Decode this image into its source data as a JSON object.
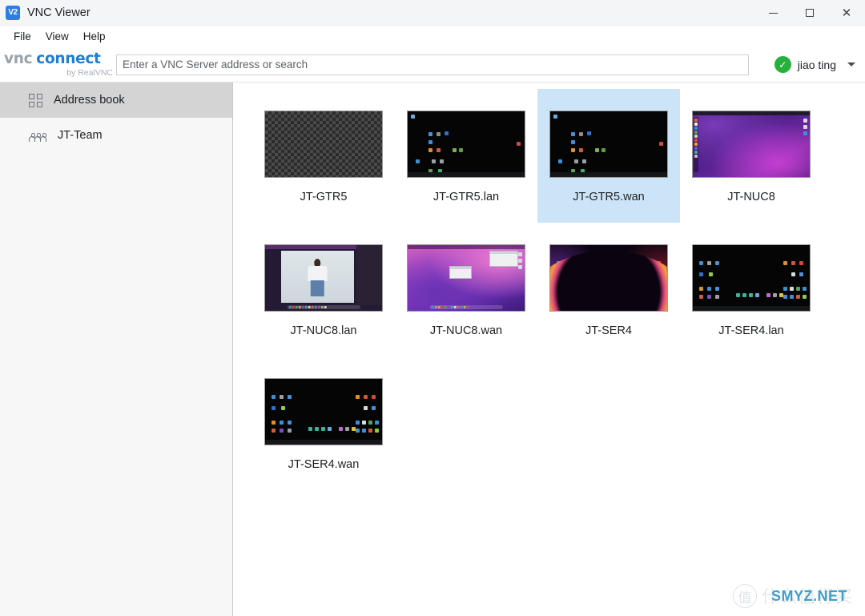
{
  "window": {
    "title": "VNC Viewer",
    "app_icon": "vnc-viewer-icon",
    "app_icon_text": "V2",
    "minimize_label": "Minimize",
    "maximize_label": "Maximize",
    "close_label": "Close",
    "close_glyph": "✕"
  },
  "menubar": {
    "items": [
      {
        "label": "File"
      },
      {
        "label": "View"
      },
      {
        "label": "Help"
      }
    ]
  },
  "toolbar": {
    "brand_primary": "vnc",
    "brand_secondary": "connect",
    "brand_sub": "by RealVNC",
    "search_placeholder": "Enter a VNC Server address or search",
    "search_value": "",
    "user_name": "jiao ting",
    "user_status_icon": "check-circle-icon",
    "user_status_glyph": "✓",
    "user_menu_icon": "chevron-down-icon"
  },
  "sidebar": {
    "items": [
      {
        "label": "Address book",
        "icon": "grid-icon",
        "selected": true
      },
      {
        "label": "JT-Team",
        "icon": "team-icon",
        "selected": false
      }
    ]
  },
  "main": {
    "connections": [
      {
        "label": "JT-GTR5",
        "thumb": "checkerboard",
        "selected": false
      },
      {
        "label": "JT-GTR5.lan",
        "thumb": "black-desktop",
        "selected": false
      },
      {
        "label": "JT-GTR5.wan",
        "thumb": "black-desktop",
        "selected": true
      },
      {
        "label": "JT-NUC8",
        "thumb": "ubuntu-desktop",
        "selected": false
      },
      {
        "label": "JT-NUC8.lan",
        "thumb": "photo-viewer",
        "selected": false
      },
      {
        "label": "JT-NUC8.wan",
        "thumb": "mac-desktop",
        "selected": false
      },
      {
        "label": "JT-SER4",
        "thumb": "arc-wallpaper",
        "selected": false
      },
      {
        "label": "JT-SER4.lan",
        "thumb": "black-icons",
        "selected": false
      },
      {
        "label": "JT-SER4.wan",
        "thumb": "black-icons",
        "selected": false
      }
    ]
  },
  "watermark": {
    "badge_glyph": "值",
    "text_cn": "什么值得买",
    "text_site": "SMYZ.NET"
  },
  "colors": {
    "accent_blue": "#1f7fd4",
    "selection_blue": "#cce4f7",
    "sidebar_selected": "#d4d4d4",
    "status_green": "#27b03b",
    "watermark_blue": "#3f9fd0"
  }
}
